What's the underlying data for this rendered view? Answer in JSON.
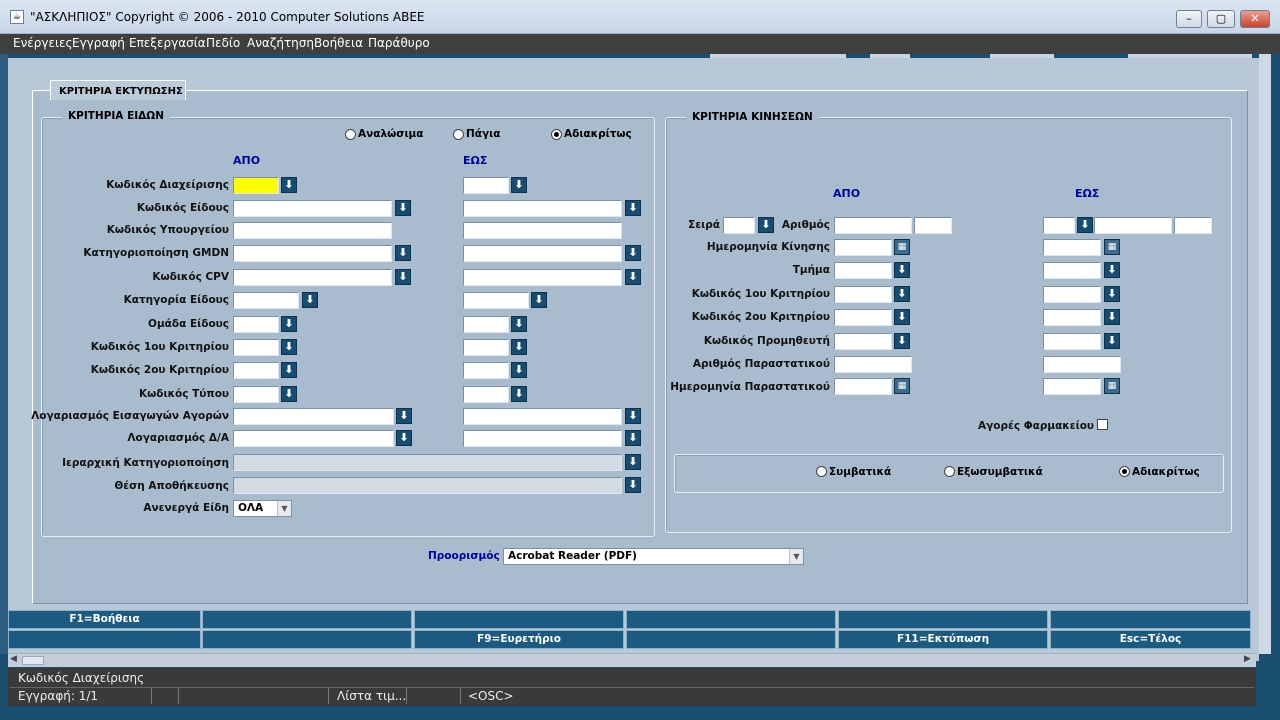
{
  "window": {
    "title": "\"ΑΣΚΛΗΠΙΟΣ\" Copyright © 2006 - 2010 Computer Solutions ABEE",
    "min": "–",
    "max": "▢",
    "close": "✕"
  },
  "menu": [
    "Ενέργειες",
    "Εγγραφή",
    "Επεξεργασία",
    "Πεδίο",
    "Αναζήτηση",
    "Βοήθεια",
    "Παράθυρο"
  ],
  "form": {
    "tab_title": "ΚΡΙΤΗΡΙΑ ΕΚΤΥΠΩΣΗΣ",
    "items": {
      "title": "ΚΡΙΤΗΡΙΑ ΕΙΔΩΝ",
      "radios": [
        {
          "label": "Αναλώσιμα",
          "selected": false
        },
        {
          "label": "Πάγια",
          "selected": false
        },
        {
          "label": "Αδιακρίτως",
          "selected": true
        }
      ],
      "from_header": "ΑΠΟ",
      "to_header": "ΕΩΣ",
      "rows": [
        {
          "label": "Κωδικός Διαχείρισης",
          "from_value": "",
          "to_value": ""
        },
        {
          "label": "Κωδικός Είδους",
          "from_value": "",
          "to_value": ""
        },
        {
          "label": "Κωδικός Υπουργείου",
          "from_value": "",
          "to_value": ""
        },
        {
          "label": "Κατηγοριοποίηση GMDN",
          "from_value": "",
          "to_value": ""
        },
        {
          "label": "Κωδικός CPV",
          "from_value": "",
          "to_value": ""
        },
        {
          "label": "Κατηγορία Είδους",
          "from_value": "",
          "to_value": ""
        },
        {
          "label": "Ομάδα Είδους",
          "from_value": "",
          "to_value": ""
        },
        {
          "label": "Κωδικός 1ου Κριτηρίου",
          "from_value": "",
          "to_value": ""
        },
        {
          "label": "Κωδικός 2ου Κριτηρίου",
          "from_value": "",
          "to_value": ""
        },
        {
          "label": "Κωδικός Τύπου",
          "from_value": "",
          "to_value": ""
        },
        {
          "label": "Λογαριασμός Εισαγωγών Αγορών",
          "from_value": "",
          "to_value": ""
        },
        {
          "label": "Λογαριασμός Δ/Α",
          "from_value": "",
          "to_value": ""
        },
        {
          "label": "Ιεραρχική Κατηγοριοποίηση",
          "value": ""
        },
        {
          "label": "Θέση Αποθήκευσης",
          "value": ""
        }
      ],
      "inactive_label": "Ανενεργά Είδη",
      "inactive_value": "ΟΛΑ"
    },
    "movements": {
      "title": "ΚΡΙΤΗΡΙΑ ΚΙΝΗΣΕΩΝ",
      "from_header": "ΑΠΟ",
      "to_header": "ΕΩΣ",
      "series_label": "Σειρά",
      "number_label": "Αριθμός",
      "rows": [
        {
          "label": "Ημερομηνία Κίνησης",
          "from_value": "",
          "to_value": ""
        },
        {
          "label": "Τμήμα",
          "from_value": "",
          "to_value": ""
        },
        {
          "label": "Κωδικός 1ου Κριτηρίου",
          "from_value": "",
          "to_value": ""
        },
        {
          "label": "Κωδικός 2ου Κριτηρίου",
          "from_value": "",
          "to_value": ""
        },
        {
          "label": "Κωδικός Προμηθευτή",
          "from_value": "",
          "to_value": ""
        },
        {
          "label": "Αριθμός Παραστατικού",
          "from_value": "",
          "to_value": ""
        },
        {
          "label": "Ημερομηνία Παραστατικού",
          "from_value": "",
          "to_value": ""
        }
      ],
      "pharmacy_label": "Αγορές Φαρμακείου",
      "pharmacy_checked": false,
      "radios": [
        {
          "label": "Συμβατικά",
          "selected": false
        },
        {
          "label": "Εξωσυμβατικά",
          "selected": false
        },
        {
          "label": "Αδιακρίτως",
          "selected": true
        }
      ]
    },
    "destination_label": "Προορισμός",
    "destination_value": "Acrobat Reader (PDF)"
  },
  "fkeys": {
    "row1": [
      "F1=Βοήθεια",
      "",
      "",
      "",
      "",
      ""
    ],
    "row2": [
      "",
      "",
      "F9=Ευρετήριο",
      "",
      "F11=Εκτύπωση",
      "Esc=Τέλος"
    ]
  },
  "status": {
    "hint": "Κωδικός Διαχείρισης",
    "record": "Εγγραφή: 1/1",
    "list": "Λίστα τιμ...",
    "mode": "<OSC>"
  },
  "icons": {
    "lov": "arrow-down-icon",
    "calendar": "calendar-icon",
    "app": "java-cup-icon"
  },
  "colors": {
    "canvas": "#b9c8d6",
    "frame": "#a9bccd",
    "fkey": "#1c5a82",
    "required_field": "#ffff00",
    "header_blue": "#00009c"
  }
}
